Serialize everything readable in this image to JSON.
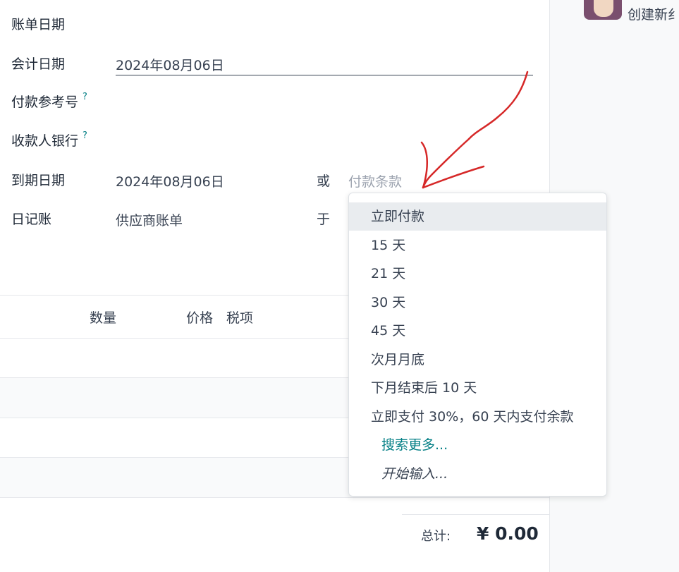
{
  "form": {
    "bill_date_label": "账单日期",
    "accounting_date_label": "会计日期",
    "accounting_date_value": "2024年08月06日",
    "payment_ref_label": "付款参考号",
    "payee_bank_label": "收款人银行",
    "help_mark": "?",
    "due_date_label": "到期日期",
    "due_date_value": "2024年08月06日",
    "or_label": "或",
    "payment_terms_placeholder": "付款条款",
    "journal_label": "日记账",
    "journal_value": "供应商账单",
    "in_label": "于"
  },
  "table": {
    "headers": [
      "数量",
      "价格",
      "税项"
    ]
  },
  "totals": {
    "label": "总计:",
    "value": "¥ 0.00"
  },
  "dropdown": {
    "options": [
      "立即付款",
      "15 天",
      "21 天",
      "30 天",
      "45 天",
      "次月月底",
      "下月结束后 10 天",
      "立即支付 30%，60 天内支付余款"
    ],
    "search_more": "搜索更多...",
    "start_typing": "开始输入..."
  },
  "chatter": {
    "create_label": "创建新纟"
  },
  "colors": {
    "accent": "#017e84",
    "annotation": "#d62828"
  }
}
